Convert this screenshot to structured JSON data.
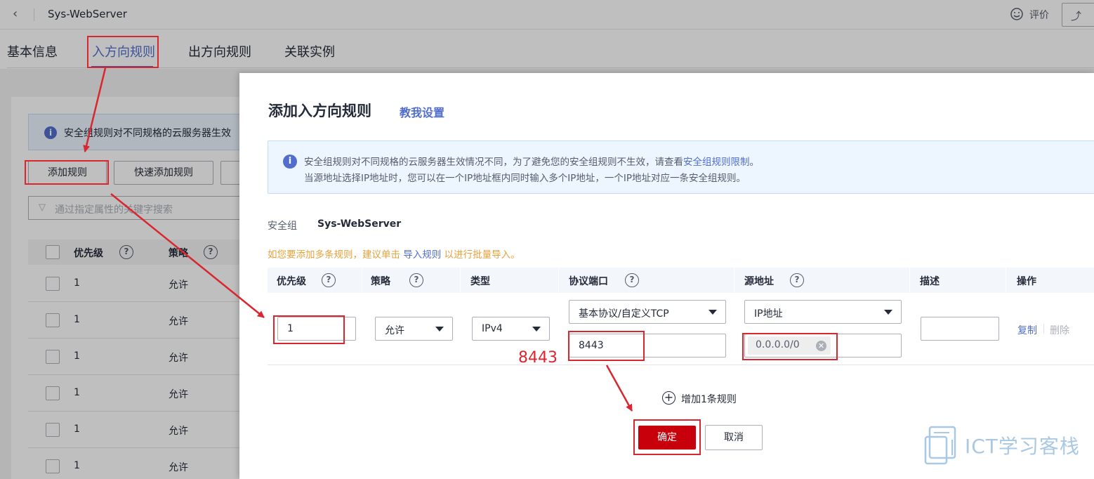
{
  "header": {
    "title": "Sys-WebServer",
    "rate_label": "评价"
  },
  "tabs": [
    {
      "label": "基本信息"
    },
    {
      "label": "入方向规则"
    },
    {
      "label": "出方向规则"
    },
    {
      "label": "关联实例"
    }
  ],
  "background": {
    "alert": "安全组规则对不同规格的云服务器生效",
    "buttons": {
      "add_rule": "添加规则",
      "quick_add": "快速添加规则"
    },
    "search_placeholder": "通过指定属性的关键字搜索",
    "columns": {
      "priority": "优先级",
      "policy": "策略"
    },
    "rows": [
      {
        "priority": "1",
        "policy": "允许"
      },
      {
        "priority": "1",
        "policy": "允许"
      },
      {
        "priority": "1",
        "policy": "允许"
      },
      {
        "priority": "1",
        "policy": "允许"
      },
      {
        "priority": "1",
        "policy": "允许"
      },
      {
        "priority": "1",
        "policy": "允许"
      }
    ]
  },
  "dialog": {
    "title": "添加入方向规则",
    "teach_link": "教我设置",
    "alert": {
      "line1_prefix": "安全组规则对不同规格的云服务器生效情况不同，为了避免您的安全组规则不生效，请查看",
      "line1_link": "安全组规则限制",
      "line1_suffix": "。",
      "line2": "当源地址选择IP地址时，您可以在一个IP地址框内同时输入多个IP地址，一个IP地址对应一条安全组规则。"
    },
    "sg_label": "安全组",
    "sg_value": "Sys-WebServer",
    "batch_hint_prefix": "如您要添加多条规则，建议单击",
    "batch_hint_link": "导入规则",
    "batch_hint_suffix": "以进行批量导入。",
    "columns": {
      "priority": "优先级",
      "policy": "策略",
      "type": "类型",
      "protocol_port": "协议端口",
      "source": "源地址",
      "description": "描述",
      "action": "操作"
    },
    "row": {
      "priority": "1",
      "policy": "允许",
      "type": "IPv4",
      "protocol": "基本协议/自定义TCP",
      "port": "8443",
      "source_type": "IP地址",
      "source_ip": "0.0.0.0/0",
      "description": "",
      "copy": "复制",
      "delete": "删除"
    },
    "add_more": "增加1条规则",
    "ok": "确定",
    "cancel": "取消"
  },
  "annotation": {
    "port_note": "8443",
    "color": "#d9262f"
  },
  "watermark": {
    "text": "ICT学习客栈"
  },
  "colors": {
    "accent": "#526ecc",
    "primary_button": "#c7000b",
    "warning_text": "#e6a23c"
  }
}
